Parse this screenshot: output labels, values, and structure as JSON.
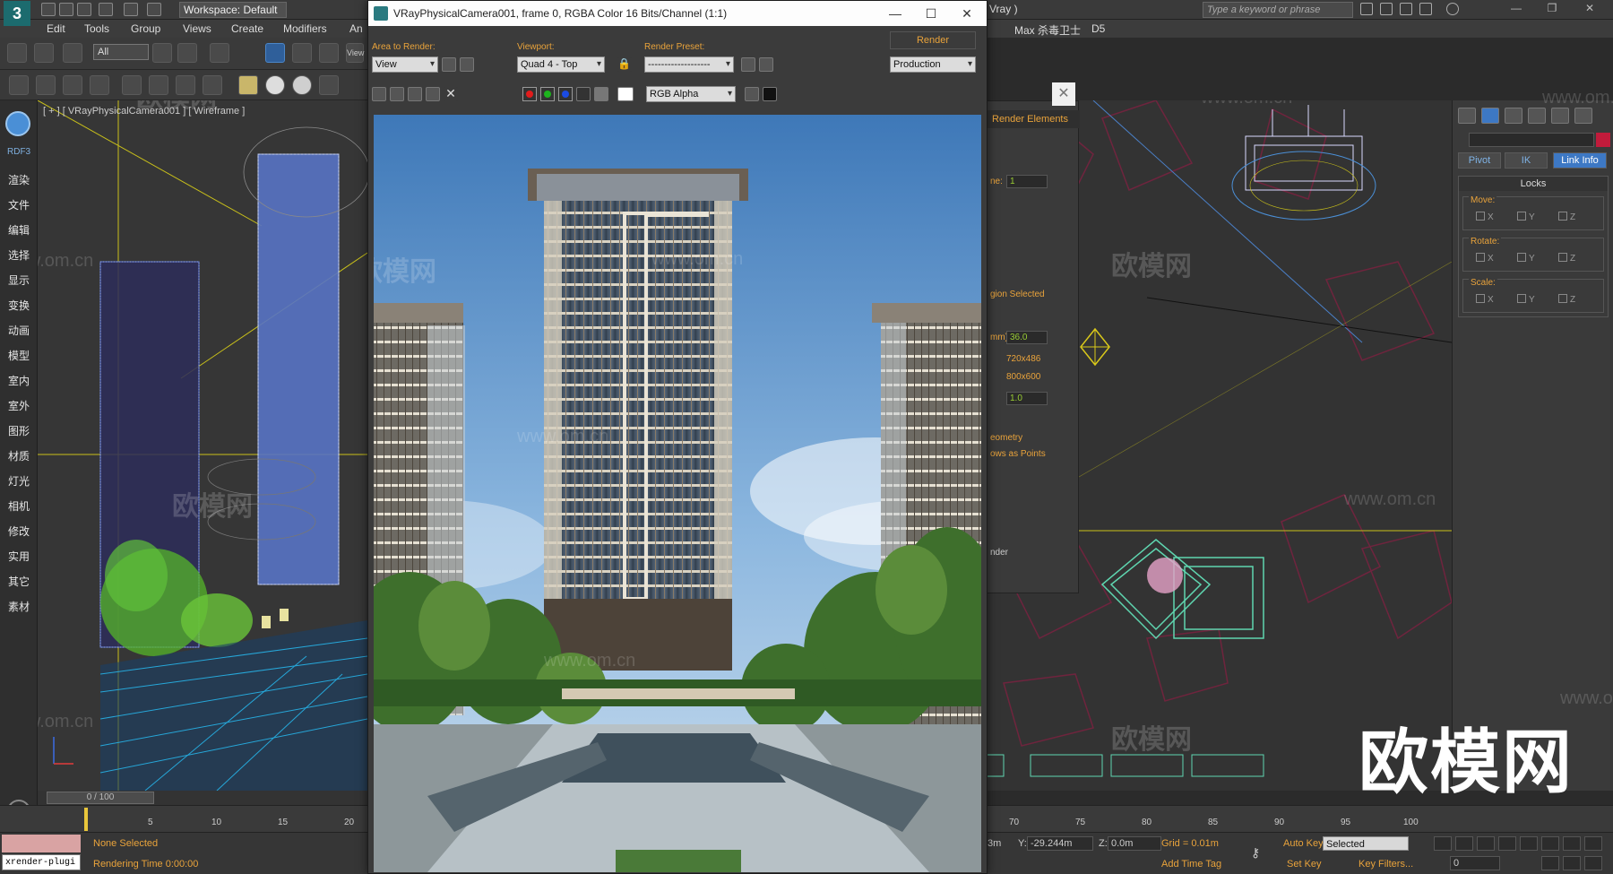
{
  "app": {
    "workspace": "Workspace: Default",
    "menu": [
      "Edit",
      "Tools",
      "Group",
      "Views",
      "Create",
      "Modifiers",
      "An"
    ],
    "menu_right": [
      "Vray )",
      "Max 杀毒卫士",
      "D5"
    ],
    "search_placeholder": "Type a keyword or phrase",
    "selection_filter": "All",
    "view_label": "View"
  },
  "left_strip": {
    "brand": "RDF3",
    "items": [
      "渲染",
      "文件",
      "编辑",
      "选择",
      "显示",
      "变换",
      "动画",
      "模型",
      "室内",
      "室外",
      "图形",
      "材质",
      "灯光",
      "相机",
      "修改",
      "实用",
      "其它",
      "素材"
    ]
  },
  "viewport_left": {
    "label": "[ + ] [ VRayPhysicalCamera001 ] [ Wireframe ]"
  },
  "render_setup": {
    "tab": "Render Elements",
    "frame_label": "ne:",
    "frame_value": "1",
    "region_label": "gion Selected",
    "focal_label": "mm):",
    "focal_value": "36.0",
    "res1": "720x486",
    "res2": "800x600",
    "aspect_value": "1.0",
    "geometry": "eometry",
    "points": "ows as Points",
    "render_label": "nder"
  },
  "vfb": {
    "title": "VRayPhysicalCamera001, frame 0, RGBA Color 16 Bits/Channel (1:1)",
    "area_label": "Area to Render:",
    "area_value": "View",
    "viewport_label": "Viewport:",
    "viewport_value": "Quad 4 - Top",
    "preset_label": "Render Preset:",
    "preset_value": "-------------------",
    "render_button": "Render",
    "production": "Production",
    "channel": "RGB Alpha",
    "channel_colors": [
      "#e21b1b",
      "#1db31d",
      "#1b4be2"
    ]
  },
  "command_panel": {
    "buttons": [
      "Pivot",
      "IK",
      "Link Info"
    ],
    "rollout": "Locks",
    "groups": [
      "Move:",
      "Rotate:",
      "Scale:"
    ],
    "axes": [
      "X",
      "Y",
      "Z"
    ],
    "accent": "#c11b3b"
  },
  "timeline": {
    "frame": "0 / 100",
    "ticks_left": [
      "5",
      "10",
      "15",
      "20"
    ],
    "ticks_right": [
      "70",
      "75",
      "80",
      "85",
      "90",
      "95",
      "100"
    ]
  },
  "status": {
    "listener": "xrender-plugi",
    "selection": "None Selected",
    "rendering_time": "Rendering Time  0:00:00",
    "x_label": "3m",
    "y_label": "Y:",
    "y_value": "-29.244m",
    "z_label": "Z:",
    "z_value": "0.0m",
    "grid": "Grid = 0.01m",
    "add_time_tag": "Add Time Tag",
    "auto_key": "Auto Key",
    "set_key": "Set Key",
    "selected": "Selected",
    "key_filters": "Key Filters...",
    "frame_value": "0"
  },
  "watermarks": {
    "brand": "欧模网",
    "url": "www.om.cn"
  }
}
